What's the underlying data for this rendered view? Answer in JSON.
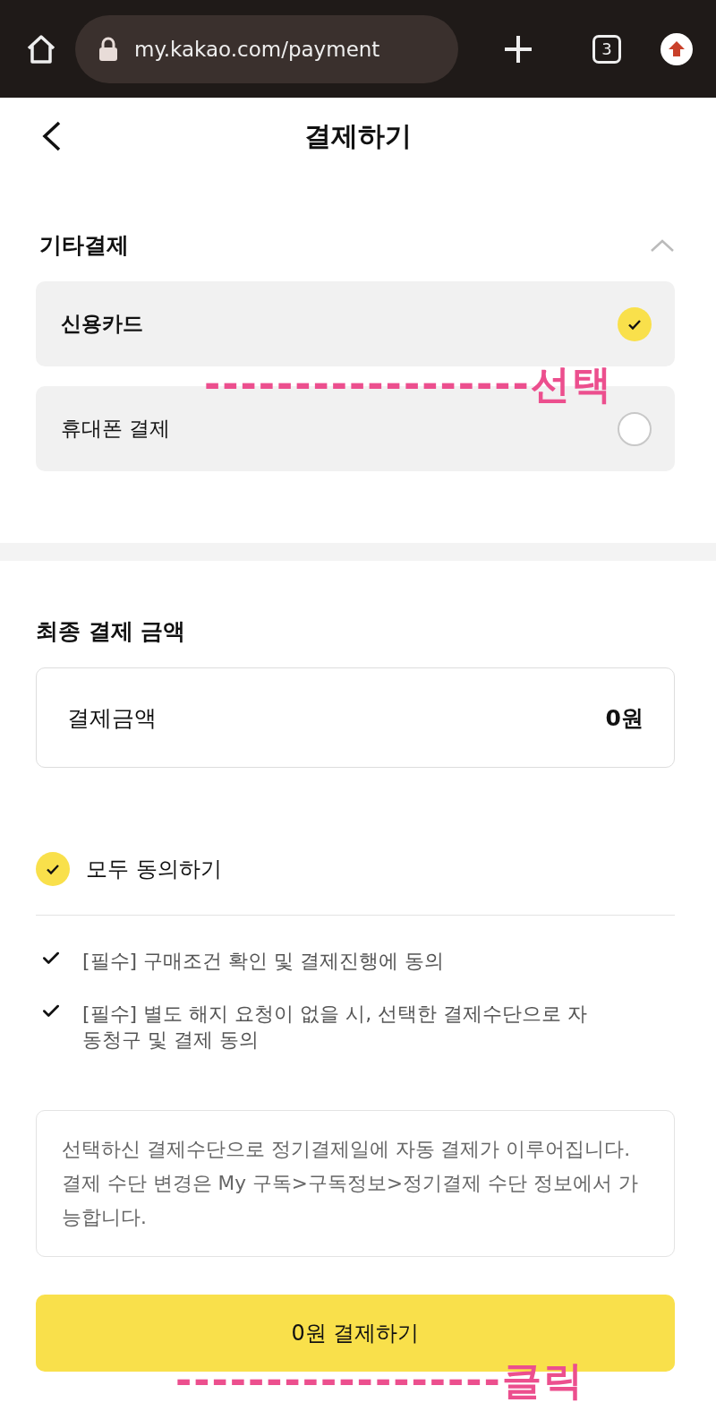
{
  "browser": {
    "url": "my.kakao.com/payment",
    "tab_count": "3"
  },
  "header": {
    "title": "결제하기"
  },
  "other_payment": {
    "title": "기타결제",
    "expanded": true,
    "options": [
      {
        "label": "신용카드",
        "selected": true
      },
      {
        "label": "휴대폰 결제",
        "selected": false
      }
    ]
  },
  "final_amount": {
    "title": "최종 결제 금액",
    "label": "결제금액",
    "value": "0원"
  },
  "agree_all": {
    "label": "모두 동의하기",
    "checked": true
  },
  "consents": [
    {
      "text": "[필수] 구매조건 확인 및 결제진행에 동의",
      "checked": true
    },
    {
      "text": "[필수] 별도 해지 요청이 없을 시, 선택한 결제수단으로 자동청구 및 결제 동의",
      "checked": true
    }
  ],
  "notice": "선택하신 결제수단으로 정기결제일에 자동 결제가 이루어집니다. 결제 수단 변경은 My 구독>구독정보>정기결제 수단 정보에서 가능합니다.",
  "pay_button": "0원 결제하기",
  "annotations": [
    "------------------선택",
    "------------------클릭"
  ]
}
